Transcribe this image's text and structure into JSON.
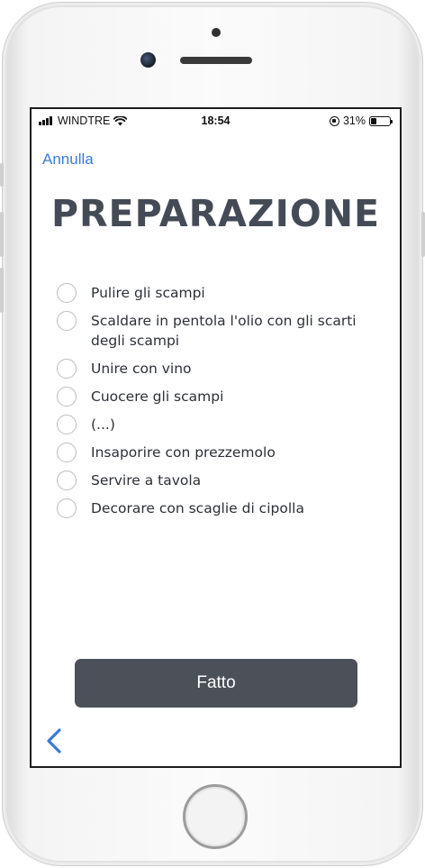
{
  "status_bar": {
    "carrier": "WINDTRE",
    "time": "18:54",
    "battery": "31%",
    "battery_level": 0.31
  },
  "nav": {
    "cancel_label": "Annulla"
  },
  "title": "PREPARAZIONE",
  "steps": [
    "Pulire gli scampi",
    "Scaldare in pentola l'olio con gli scarti degli scampi",
    "Unire con vino",
    "Cuocere gli scampi",
    "(...)",
    "Insaporire con prezzemolo",
    "Servire a tavola",
    "Decorare con scaglie di cipolla"
  ],
  "done_label": "Fatto",
  "icons": {
    "back": "chevron-left-icon",
    "wifi": "wifi-icon",
    "signal": "signal-icon",
    "rotation_lock": "rotation-lock-icon",
    "battery": "battery-icon"
  },
  "colors": {
    "accent": "#3a7bd5",
    "title": "#454b56",
    "button": "#4b5059"
  }
}
